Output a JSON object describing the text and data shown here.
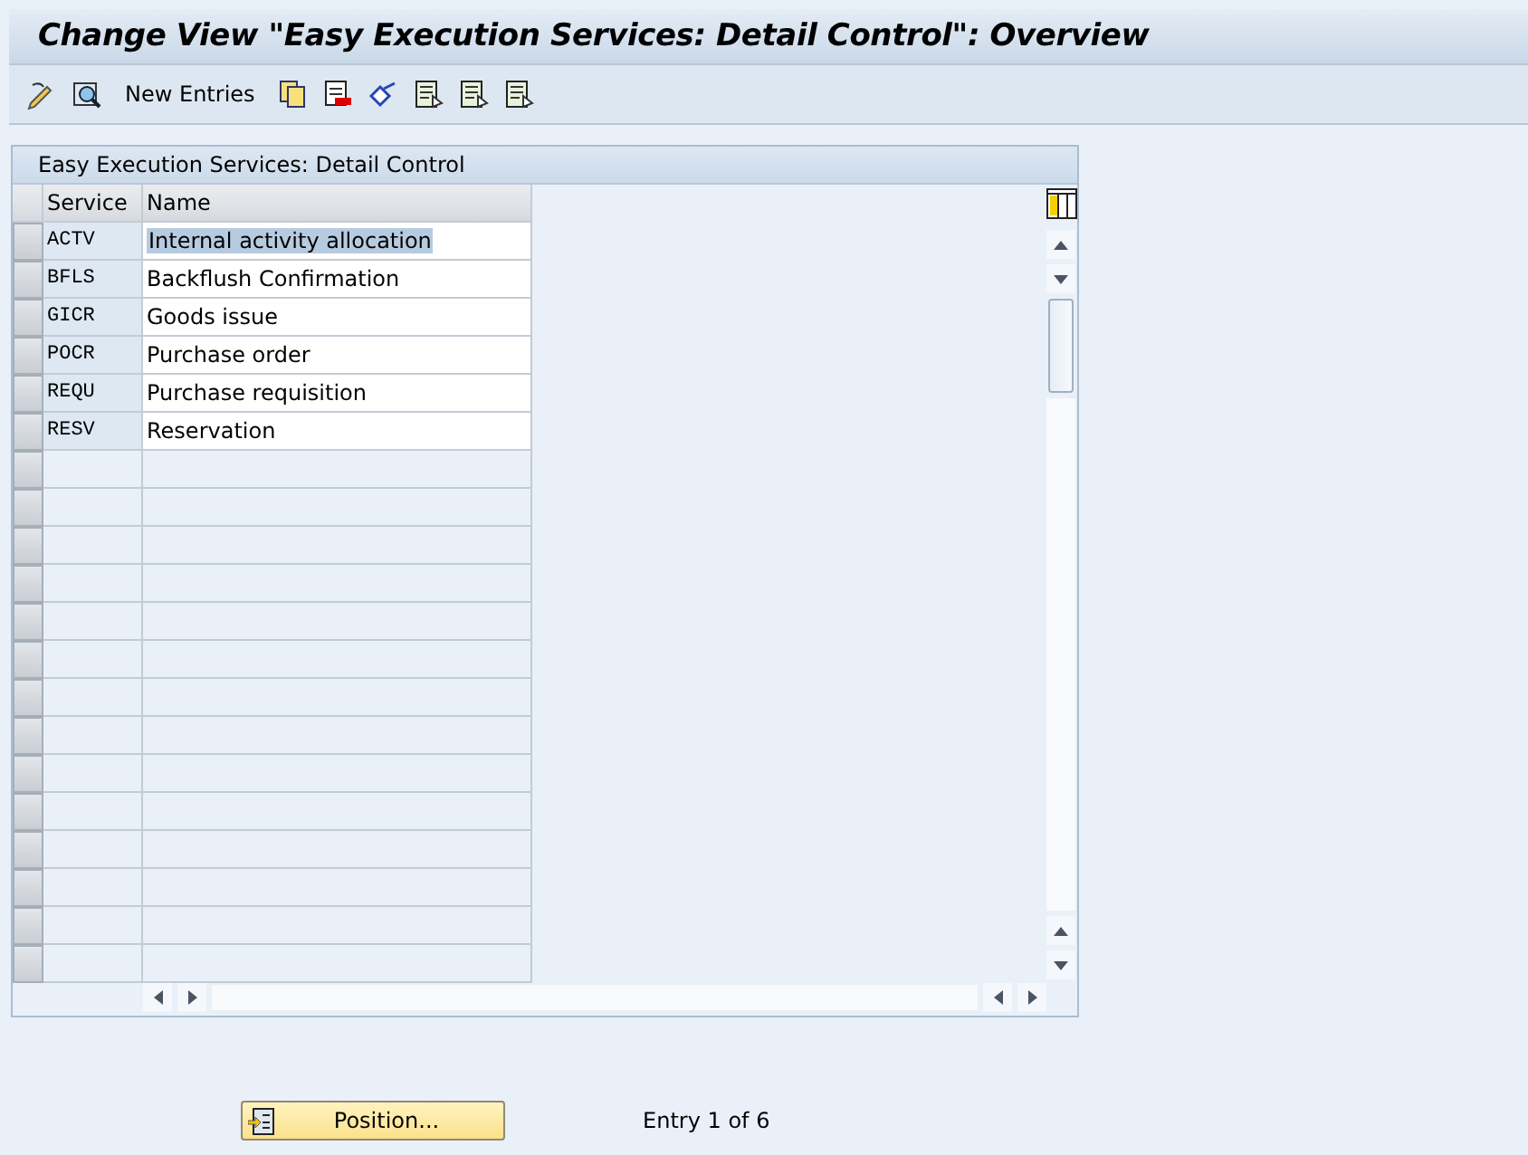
{
  "window": {
    "title": "Change View \"Easy Execution Services: Detail Control\": Overview"
  },
  "toolbar": {
    "new_entries": "New Entries"
  },
  "table": {
    "title": "Easy Execution Services: Detail Control",
    "columns": [
      "Service",
      "Name"
    ],
    "rows": [
      {
        "service": "ACTV",
        "name": "Internal activity allocation",
        "selected": true
      },
      {
        "service": "BFLS",
        "name": "Backflush Confirmation",
        "selected": false
      },
      {
        "service": "GICR",
        "name": "Goods issue",
        "selected": false
      },
      {
        "service": "POCR",
        "name": "Purchase order",
        "selected": false
      },
      {
        "service": "REQU",
        "name": "Purchase requisition",
        "selected": false
      },
      {
        "service": "RESV",
        "name": "Reservation",
        "selected": false
      }
    ]
  },
  "footer": {
    "position_button": "Position...",
    "entry_info": "Entry 1 of 6"
  }
}
